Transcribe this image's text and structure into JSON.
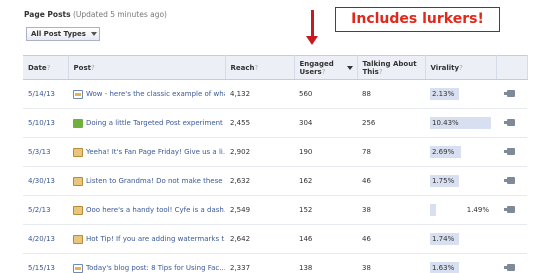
{
  "header": {
    "title": "Page Posts",
    "subtitle": "(Updated 5 minutes ago)"
  },
  "filter": {
    "label": "All Post Types"
  },
  "callout": {
    "text": "Includes lurkers!"
  },
  "columns": {
    "date": "Date",
    "post": "Post",
    "reach": "Reach",
    "engaged": "Engaged Users",
    "talking": "Talking About This",
    "virality": "Virality",
    "qmark": "?"
  },
  "rows": [
    {
      "date": "5/14/13",
      "icon": "link",
      "post": "Wow - here's the classic example of wha...",
      "reach": "4,132",
      "engaged": "560",
      "talking": "88",
      "virality": "2.13%",
      "virality_fraction": 0.48,
      "promote": true
    },
    {
      "date": "5/10/13",
      "icon": "status",
      "post": "Doing a little Targeted Post experiment ...",
      "reach": "2,455",
      "engaged": "304",
      "talking": "256",
      "virality": "10.43%",
      "virality_fraction": 1.0,
      "promote": true
    },
    {
      "date": "5/3/13",
      "icon": "photo",
      "post": "Yeeha! It's Fan Page Friday! Give us a li...",
      "reach": "2,902",
      "engaged": "190",
      "talking": "78",
      "virality": "2.69%",
      "virality_fraction": 0.5,
      "promote": true
    },
    {
      "date": "4/30/13",
      "icon": "photo",
      "post": "Listen to Grandma! Do not make these s...",
      "reach": "2,632",
      "engaged": "162",
      "talking": "46",
      "virality": "1.75%",
      "virality_fraction": 0.47,
      "promote": true
    },
    {
      "date": "5/2/13",
      "icon": "photo",
      "post": "Ooo here's a handy tool! Cyfe is a dash...",
      "reach": "2,549",
      "engaged": "152",
      "talking": "38",
      "virality": "1.49%",
      "virality_fraction": 0.1,
      "promote": true
    },
    {
      "date": "4/20/13",
      "icon": "photo",
      "post": "Hot Tip! If you are adding watermarks t...",
      "reach": "2,642",
      "engaged": "146",
      "talking": "46",
      "virality": "1.74%",
      "virality_fraction": 0.47,
      "promote": false
    },
    {
      "date": "5/15/13",
      "icon": "link",
      "post": "Today's blog post: 8 Tips for Using Fac...",
      "reach": "2,337",
      "engaged": "138",
      "talking": "38",
      "virality": "1.63%",
      "virality_fraction": 0.47,
      "promote": true
    }
  ]
}
